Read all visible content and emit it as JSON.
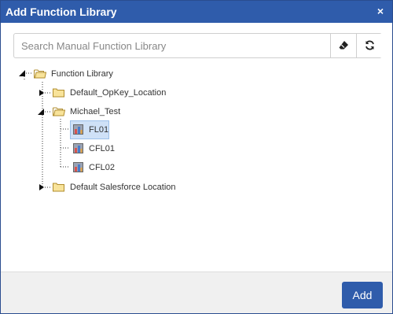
{
  "dialog": {
    "title": "Add Function Library",
    "close_glyph": "×"
  },
  "search": {
    "placeholder": "Search Manual Function Library",
    "value": "",
    "clear_icon": "eraser-icon",
    "refresh_icon": "refresh-icon"
  },
  "tree": {
    "root": {
      "label": "Function Library",
      "expanded": true
    },
    "items": [
      {
        "label": "Default_OpKey_Location",
        "type": "folder",
        "expanded": false
      },
      {
        "label": "Michael_Test",
        "type": "folder",
        "expanded": true,
        "children": [
          {
            "label": "FL01",
            "type": "library",
            "selected": true
          },
          {
            "label": "CFL01",
            "type": "library",
            "selected": false
          },
          {
            "label": "CFL02",
            "type": "library",
            "selected": false
          }
        ]
      },
      {
        "label": "Default Salesforce Location",
        "type": "folder",
        "expanded": false
      }
    ]
  },
  "footer": {
    "add_label": "Add"
  },
  "colors": {
    "accent": "#2f5cab",
    "selection": "#cfe1f7",
    "folder": "#f5d97a"
  }
}
